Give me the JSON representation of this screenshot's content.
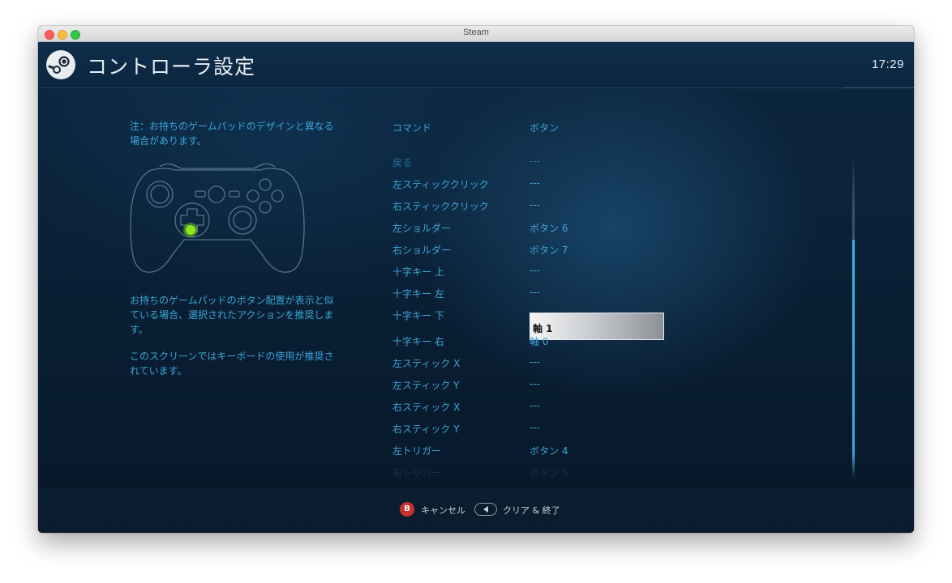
{
  "window": {
    "title": "Steam"
  },
  "header": {
    "title": "コントローラ設定",
    "clock": "17:29"
  },
  "left_panel": {
    "note": "注：お持ちのゲームパッドのデザインと異なる場合があります。",
    "desc1": "お持ちのゲームパッドのボタン配置が表示と似ている場合、選択されたアクションを推奨します。",
    "desc2": "このスクリーンではキーボードの使用が推奨されています。"
  },
  "table": {
    "col_command": "コマンド",
    "col_button": "ボタン",
    "rows": [
      {
        "command": "戻る",
        "value": "---"
      },
      {
        "command": "左スティッククリック",
        "value": "---"
      },
      {
        "command": "右スティッククリック",
        "value": "---"
      },
      {
        "command": "左ショルダー",
        "value": "ボタン 6"
      },
      {
        "command": "右ショルダー",
        "value": "ボタン 7"
      },
      {
        "command": "十字キー 上",
        "value": "---"
      },
      {
        "command": "十字キー 左",
        "value": "---"
      },
      {
        "command": "十字キー 下",
        "value": "軸 1"
      },
      {
        "command": "十字キー 右",
        "value": "軸 0"
      },
      {
        "command": "左スティック X",
        "value": "---"
      },
      {
        "command": "左スティック Y",
        "value": "---"
      },
      {
        "command": "右スティック X",
        "value": "---"
      },
      {
        "command": "右スティック Y",
        "value": "---"
      },
      {
        "command": "左トリガー",
        "value": "ボタン 4"
      },
      {
        "command": "右トリガー",
        "value": "ボタン 5"
      }
    ]
  },
  "footer": {
    "b_glyph": "B",
    "cancel": "キャンセル",
    "clear": "クリア & 終了"
  },
  "colors": {
    "accent": "#39a7d8",
    "highlight": "#7ee016",
    "b_button": "#c8312e"
  }
}
